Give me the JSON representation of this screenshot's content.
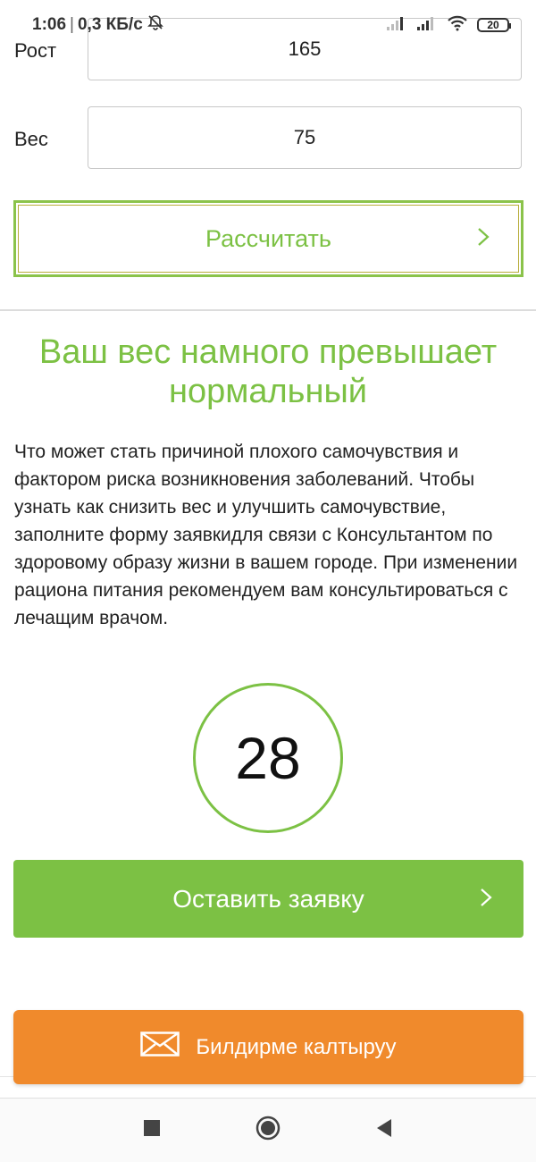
{
  "status_bar": {
    "time": "1:06",
    "speed": "0,3 КБ/с",
    "battery": "20"
  },
  "form": {
    "height_label": "Рост",
    "height_value": "165",
    "weight_label": "Вес",
    "weight_value": "75"
  },
  "calculate_button": {
    "label": "Рассчитать"
  },
  "result": {
    "title": "Ваш вес намного превышает нормальный",
    "description": "Что может стать причиной плохого самочувствия и фактором риска возникновения заболеваний. Чтобы узнать как снизить вес и улучшить самочувствие, заполните форму заявкидля связи с Консультантом по здоровому образу жизни в вашем городе. При изменении рациона питания рекомендуем вам консультироваться с лечащим врачом.",
    "bmi_value": "28"
  },
  "apply_button": {
    "label": "Оставить заявку"
  },
  "feedback_button": {
    "label": "Билдирме калтыруу"
  },
  "colors": {
    "accent_green": "#7cc144",
    "orange": "#f08a2c"
  },
  "icons": {
    "mute": "bell-off-icon",
    "signal": "signal-icon",
    "wifi": "wifi-icon",
    "chevron": "chevron-right-icon",
    "mail": "envelope-icon",
    "nav_recents": "square-icon",
    "nav_home": "circle-icon",
    "nav_back": "triangle-back-icon"
  }
}
